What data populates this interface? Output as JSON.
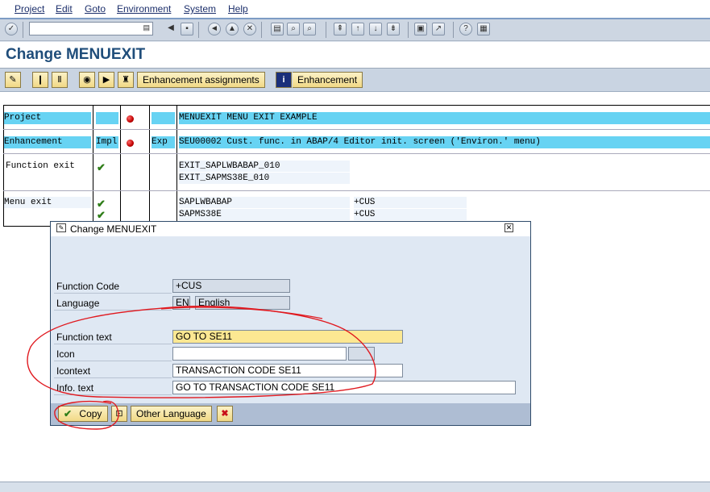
{
  "menu": [
    "Project",
    "Edit",
    "Goto",
    "Environment",
    "System",
    "Help"
  ],
  "title": "Change MENUEXIT",
  "toolbar": {
    "enh_assign_label": "Enhancement assignments",
    "enhancement_label": "Enhancement"
  },
  "grid": {
    "project_label": "Project",
    "project_value": "MENUEXIT MENU EXIT EXAMPLE",
    "enh_label": "Enhancement",
    "enh_impl": "Impl",
    "enh_exp": "Exp",
    "enh_value": "SEU00002 Cust. func. in ABAP/4 Editor init. screen ('Environ.' menu)",
    "fexit_label": "Function exit",
    "fexit_1": "EXIT_SAPLWBABAP_010",
    "fexit_2": "EXIT_SAPMS38E_010",
    "mexit_label": "Menu exit",
    "mexit_prog_1": "SAPLWBABAP",
    "mexit_code_1": "+CUS",
    "mexit_prog_2": "SAPMS38E",
    "mexit_code_2": "+CUS"
  },
  "popup": {
    "title": "Change MENUEXIT",
    "function_code_label": "Function Code",
    "function_code_value": "+CUS",
    "language_label": "Language",
    "language_code": "EN",
    "language_name": "English",
    "function_text_label": "Function text",
    "function_text_value": "GO TO SE11",
    "icon_label": "Icon",
    "icon_value": "",
    "icontext_label": "Icontext",
    "icontext_value": "TRANSACTION CODE SE11",
    "infotext_label": "Info. text",
    "infotext_value": "GO TO TRANSACTION CODE SE11",
    "copy_label": "Copy",
    "other_language_label": "Other Language"
  },
  "colors": {
    "title": "#1f4d7a",
    "highlight_row": "#67d3f3",
    "input_highlight": "#fce892",
    "annotation": "#e0191f"
  }
}
